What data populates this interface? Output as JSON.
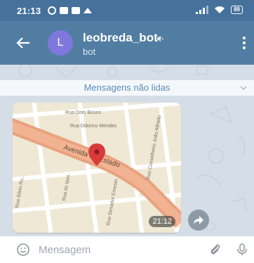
{
  "statusbar": {
    "time": "21:13",
    "battery": "89"
  },
  "header": {
    "title": "leobreda_bot",
    "subtitle": "bot",
    "avatar_letter": "L"
  },
  "chat": {
    "unread_label": "Mensagens não lidas",
    "message": {
      "time": "21:12",
      "map_labels": {
        "street1": "Avenida do Estado",
        "street2": "Rua Dom Bosco",
        "street3": "Rua Odorico Mendes",
        "street4": "Rua do Ipes",
        "street5": "Rua Conselheiro João Alfredo",
        "street6": "Rua Senador Ernesto",
        "street7": "Rua Silvio Ro..."
      }
    }
  },
  "composer": {
    "placeholder": "Mensagem"
  },
  "colors": {
    "header": "#517da2",
    "statusbar": "#45719b",
    "avatar": "#7e78de",
    "unread_text": "#5b8bb6"
  }
}
